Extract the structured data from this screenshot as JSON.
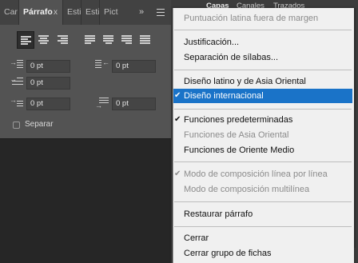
{
  "panel_tabs": {
    "tab1": "Car",
    "tab2": "Párrafo",
    "tab3": "Esti",
    "tab4": "Esti",
    "tab5": "Pict",
    "close_glyph": "x",
    "expand_glyph": "»",
    "menu_icon": "hamburger-icon"
  },
  "alignment": {
    "buttons": [
      "align-left",
      "align-center",
      "align-right",
      "justify-last-left",
      "justify-last-center",
      "justify-last-right",
      "justify-all"
    ],
    "selected": "align-left"
  },
  "indents": {
    "left_indent": "0 pt",
    "right_indent": "0 pt",
    "first_line_indent": "0 pt",
    "space_before": "0 pt",
    "space_after": "0 pt"
  },
  "hyphenate": {
    "label": "Separar",
    "checked": false
  },
  "background_tabs": {
    "tab1": "Capas",
    "tab2": "Canales",
    "tab3": "Trazados"
  },
  "menu": {
    "item_punct": "Puntuación latina fuera de margen",
    "item_justification": "Justificación...",
    "item_hyphenation": "Separación de sílabas...",
    "item_latin_asian": "Diseño latino y de Asia Oriental",
    "item_world_ready": "Diseño internacional",
    "item_default_features": "Funciones predeterminadas",
    "item_east_asian_features": "Funciones de Asia Oriental",
    "item_middle_east_features": "Funciones de Oriente Medio",
    "item_single_line": "Modo de composición línea por línea",
    "item_every_line": "Modo de composición multilínea",
    "item_reset": "Restaurar párrafo",
    "item_close": "Cerrar",
    "item_close_group": "Cerrar grupo de fichas",
    "check_glyph": "✔",
    "selected_color": "#1a73c8"
  }
}
